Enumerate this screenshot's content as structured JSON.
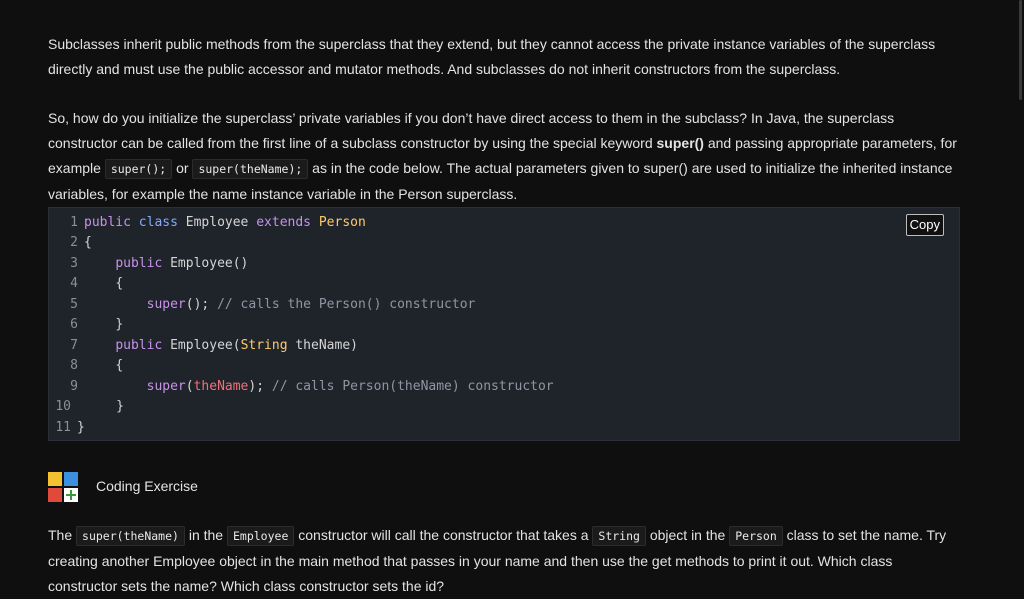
{
  "intro": {
    "text": "Subclasses inherit public methods from the superclass that they extend, but they cannot access the private instance variables of the superclass directly and must use the public accessor and mutator methods. And subclasses do not inherit constructors from the superclass."
  },
  "explain": {
    "part1": "So, how do you initialize the superclass’ private variables if you don’t have direct access to them in the subclass? In Java, the superclass constructor can be called from the first line of a subclass constructor by using the special keyword ",
    "keyword": "super()",
    "part2": " and passing appropriate parameters, for example ",
    "code1": "super();",
    "part3": " or ",
    "code2": "super(theName);",
    "part4": " as in the code below. The actual parameters given to super() are used to initialize the inherited instance variables, for example the name instance variable in the Person superclass."
  },
  "code": {
    "copy_label": "Copy",
    "lines": [
      {
        "n": "1",
        "pub": "public",
        "cls": "class",
        "name": "Employee",
        "ext": "extends",
        "sup": "Person"
      },
      {
        "n": "2",
        "t": "{"
      },
      {
        "n": "3",
        "kw": "public",
        "t": "Employee()"
      },
      {
        "n": "4",
        "t": "{"
      },
      {
        "n": "5",
        "kw": "super",
        "t": "();",
        "cm": "// calls the Person() constructor"
      },
      {
        "n": "6",
        "t": "}"
      },
      {
        "n": "7",
        "kw": "public",
        "t": "Employee(",
        "ty": "String",
        "t2": "theName)"
      },
      {
        "n": "8",
        "t": "{"
      },
      {
        "n": "9",
        "kw": "super",
        "t": "(",
        "arg": "theName",
        "t2": ");",
        "cm": "// calls Person(theName) constructor"
      },
      {
        "n": "10",
        "t": "}"
      },
      {
        "n": "11",
        "t": "}"
      }
    ]
  },
  "exercise": {
    "title": "Coding Exercise",
    "icon": "coding-exercise-icon"
  },
  "task": {
    "p1": "The ",
    "c1": "super(theName)",
    "p2": " in the ",
    "c2": "Employee",
    "p3": " constructor will call the constructor that takes a ",
    "c3": "String",
    "p4": " object in the ",
    "c4": "Person",
    "p5": " class to set the name. Try creating another Employee object in the main method that passes in your name and then use the get methods to print it out. Which class constructor sets the name? Which class constructor sets the id?"
  },
  "colors": {
    "background": "#0f0f0f",
    "code_background": "#1f232a",
    "keyword": "#c792ea",
    "type": "#82aaff",
    "class_name": "#ffcb6b",
    "comment": "#8f96a3"
  }
}
